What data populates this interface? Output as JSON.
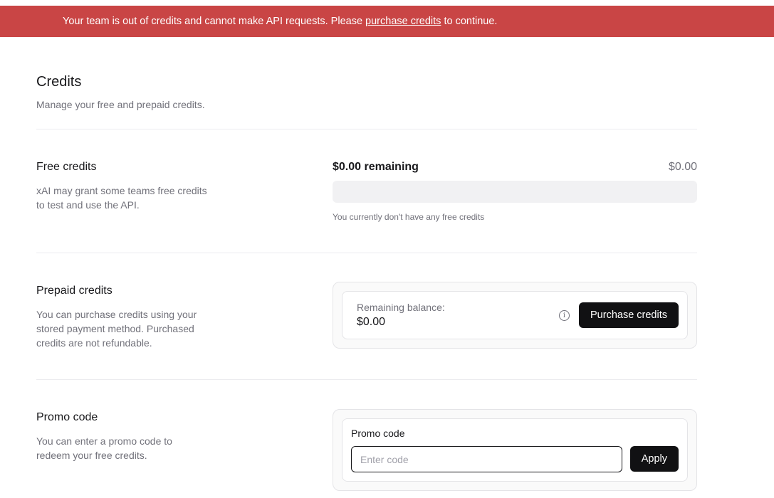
{
  "banner": {
    "text_before": "Your team is out of credits and cannot make API requests. Please ",
    "link": "purchase credits",
    "text_after": " to continue.",
    "color": "#c94545"
  },
  "header": {
    "title": "Credits",
    "subtitle": "Manage your free and prepaid credits."
  },
  "free_credits": {
    "title": "Free credits",
    "description_line1": "xAI may grant some teams free credits",
    "description_line2": "to test and use the API.",
    "remaining": "$0.00 remaining",
    "total": "$0.00",
    "progress_fraction": 0,
    "note": "You currently don't have any free credits"
  },
  "prepaid_credits": {
    "title": "Prepaid credits",
    "description_line1": "You can purchase credits using your",
    "description_line2": "stored payment method. Purchased",
    "description_line3": "credits are not refundable.",
    "balance_label": "Remaining balance:",
    "balance_value": "$0.00",
    "info_icon": "info-icon",
    "purchase_button": "Purchase credits"
  },
  "promo_code": {
    "title": "Promo code",
    "description_line1": "You can enter a promo code to",
    "description_line2": "redeem your free credits.",
    "field_label": "Promo code",
    "input_value": "",
    "input_placeholder": "Enter code",
    "apply_button": "Apply"
  }
}
